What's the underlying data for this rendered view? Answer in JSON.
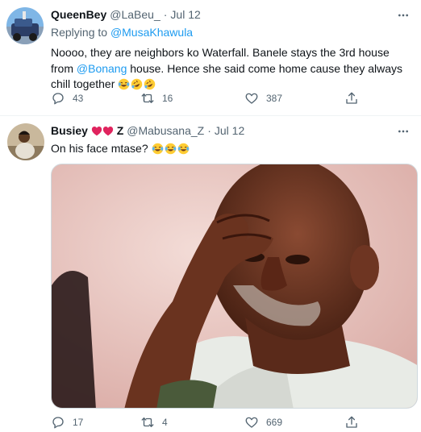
{
  "tweets": [
    {
      "name": "QueenBey",
      "handle": "@LaBeu_",
      "dot": "·",
      "date": "Jul 12",
      "replying_prefix": "Replying to",
      "replying_to": "@MusaKhawula",
      "text_part1": "Noooo, they are neighbors ko Waterfall. Banele stays the 3rd house from",
      "mention": "@Bonang",
      "text_part2": "house. Hence she said come home cause they always chill together",
      "emojis": [
        "face-with-tears-of-joy",
        "rolling-on-the-floor-laughing",
        "rolling-on-the-floor-laughing"
      ],
      "replies": "43",
      "retweets": "16",
      "likes": "387"
    },
    {
      "name_part1": "Busiey",
      "name_part2": "Z",
      "handle": "@Mabusana_Z",
      "dot": "·",
      "date": "Jul 12",
      "text": "On his face mtase?",
      "emojis": [
        "face-with-tears-of-joy",
        "face-with-tears-of-joy",
        "face-with-tears-of-joy"
      ],
      "media": "photo-of-man-with-hand-on-forehead",
      "replies": "17",
      "retweets": "4",
      "likes": "669"
    }
  ],
  "colors": {
    "link": "#1d9bf0",
    "secondary_text": "#536471",
    "primary_text": "#0f1419",
    "border": "#eff3f4"
  }
}
